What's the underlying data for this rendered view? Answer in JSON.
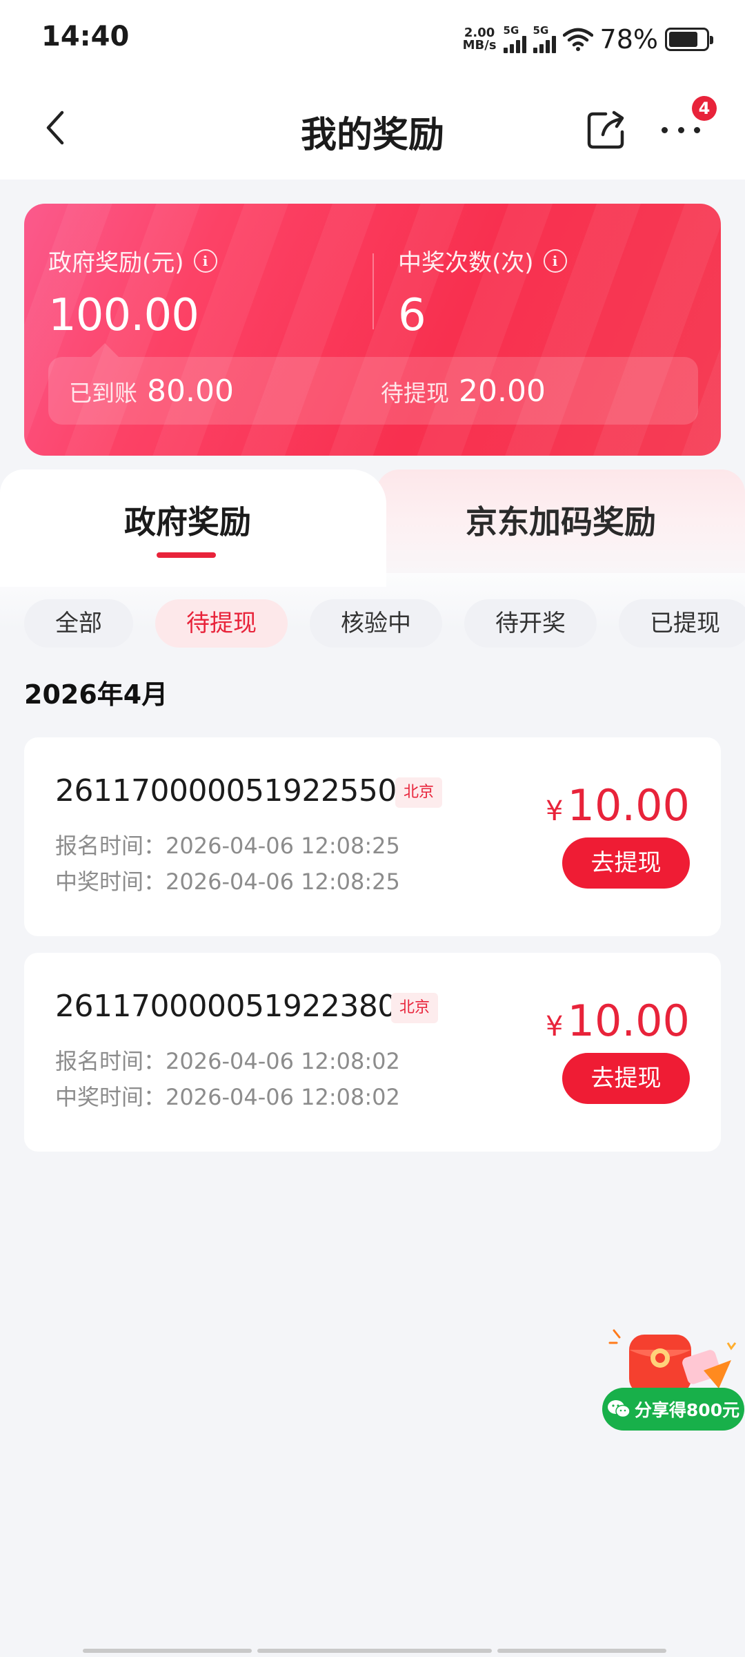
{
  "status_bar": {
    "time": "14:40",
    "net_speed_value": "2.00",
    "net_speed_unit": "MB/s",
    "signal1_label": "5G",
    "signal2_label": "5G",
    "battery_percent": "78%",
    "battery_level": 0.78
  },
  "header": {
    "title": "我的奖励",
    "notification_count": "4"
  },
  "summary": {
    "gov_reward_label": "政府奖励(元)",
    "gov_reward_value": "100.00",
    "win_count_label": "中奖次数(次)",
    "win_count_value": "6",
    "received_label": "已到账",
    "received_value": "80.00",
    "pending_label": "待提现",
    "pending_value": "20.00"
  },
  "tabs": [
    {
      "label": "政府奖励",
      "active": true
    },
    {
      "label": "京东加码奖励",
      "active": false
    }
  ],
  "filters": [
    {
      "label": "全部",
      "active": false
    },
    {
      "label": "待提现",
      "active": true
    },
    {
      "label": "核验中",
      "active": false
    },
    {
      "label": "待开奖",
      "active": false
    },
    {
      "label": "已提现",
      "active": false
    }
  ],
  "month_label": "2026年4月",
  "records": [
    {
      "id": "2611700000519225506",
      "region": "北京",
      "signup_label": "报名时间：",
      "signup_time": "2026-04-06 12:08:25",
      "win_label": "中奖时间：",
      "win_time": "2026-04-06 12:08:25",
      "currency": "¥",
      "amount": "10.00",
      "action": "去提现"
    },
    {
      "id": "2611700000519223801",
      "region": "北京",
      "signup_label": "报名时间：",
      "signup_time": "2026-04-06 12:08:02",
      "win_label": "中奖时间：",
      "win_time": "2026-04-06 12:08:02",
      "currency": "¥",
      "amount": "10.00",
      "action": "去提现"
    }
  ],
  "promo": {
    "label": "分享得800元",
    "icon": "wechat-icon"
  },
  "colors": {
    "accent": "#e8233a",
    "button": "#ef1c34",
    "promo_green": "#18b04a"
  }
}
